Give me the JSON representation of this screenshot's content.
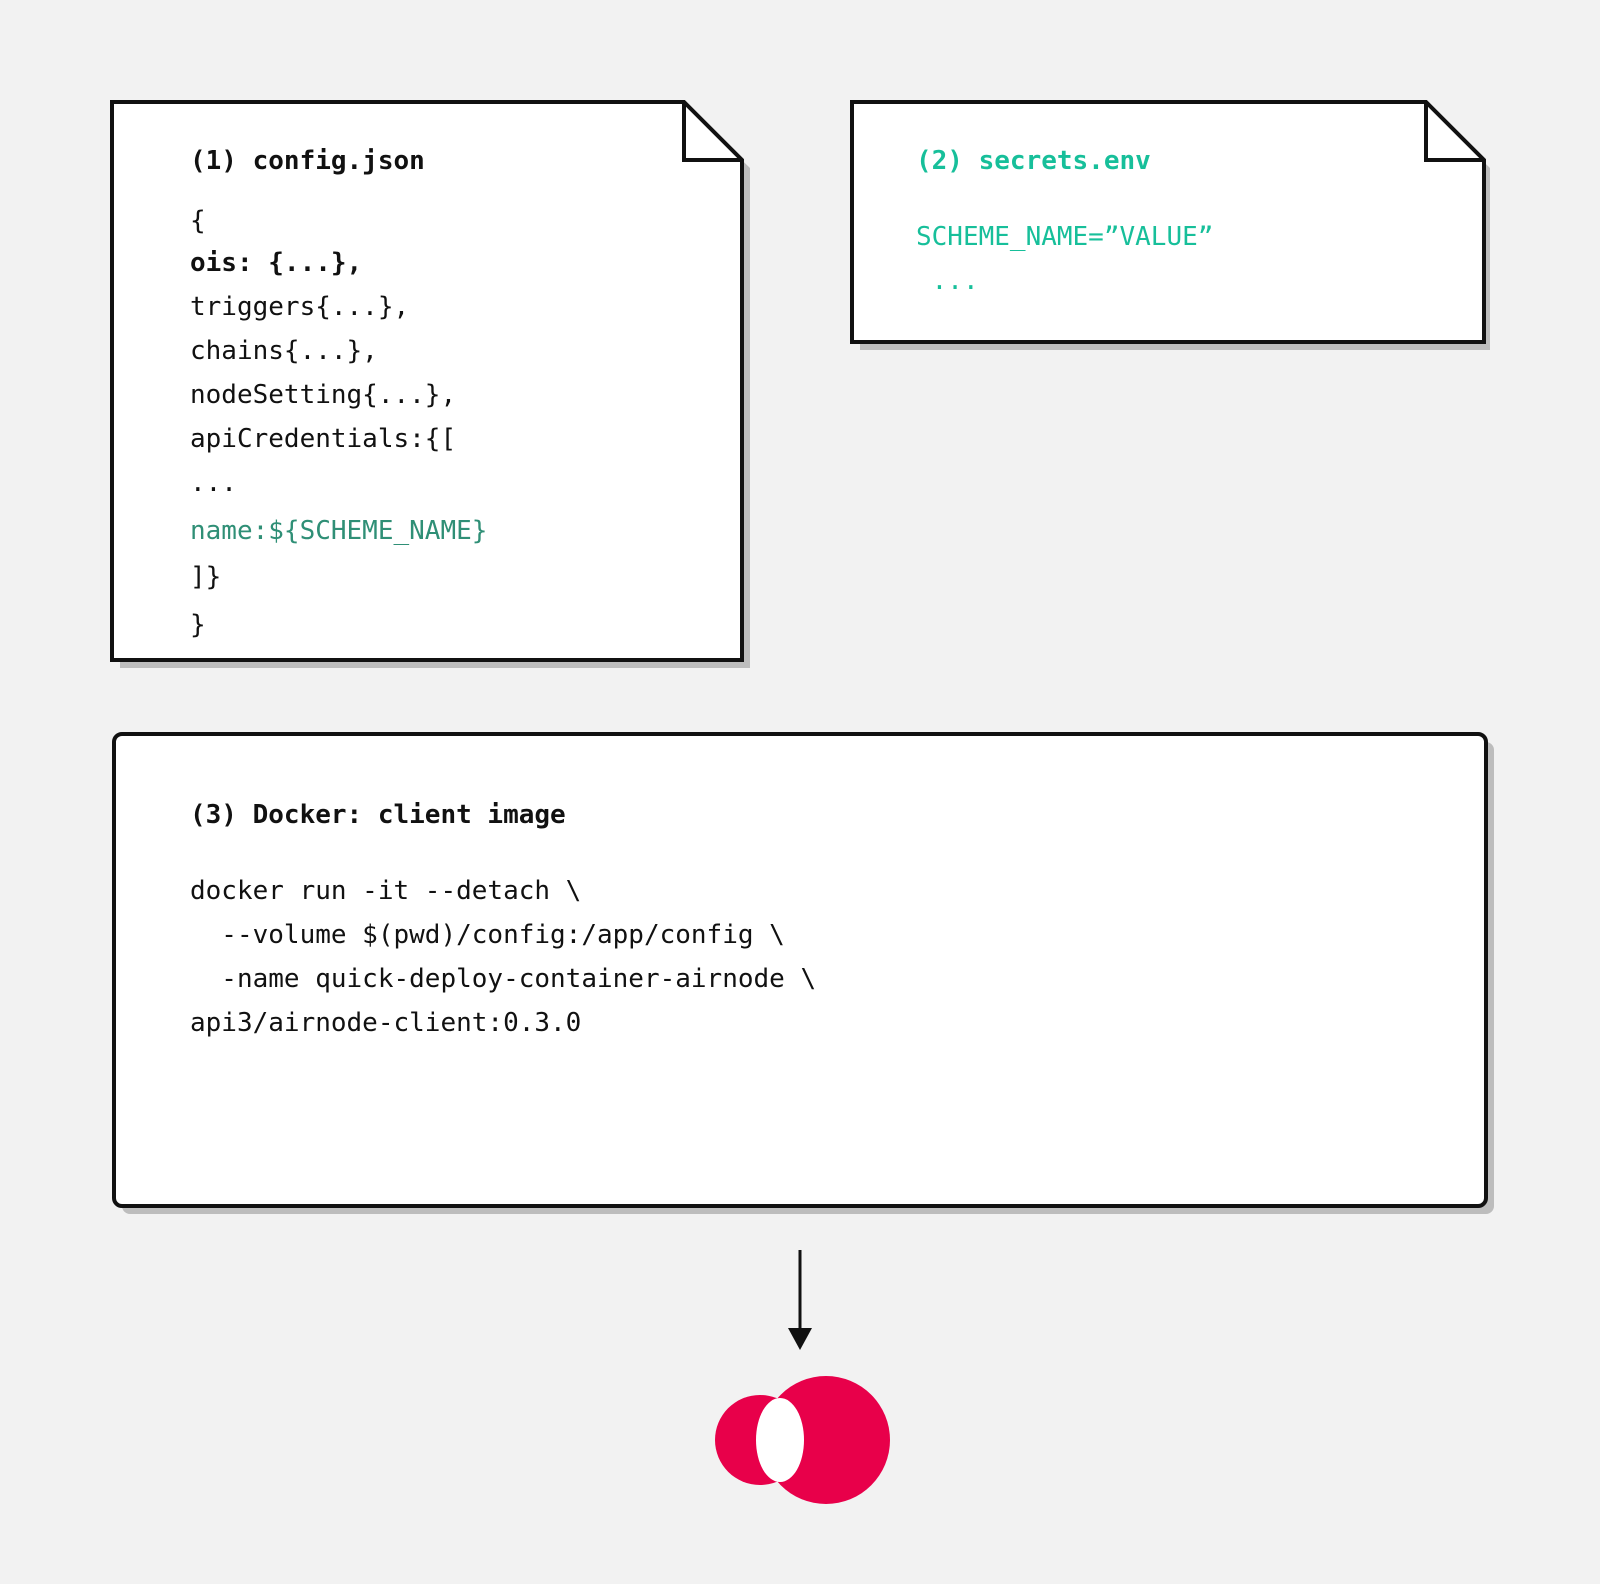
{
  "config_file": {
    "title": "(1) config.json",
    "lines": [
      "{",
      "ois: {...},",
      "triggers{...},",
      "chains{...},",
      "nodeSetting{...},",
      "apiCredentials:{[",
      "...",
      "name:${SCHEME_NAME}",
      "]}",
      "}"
    ]
  },
  "secrets_file": {
    "title": "(2) secrets.env",
    "lines": [
      "SCHEME_NAME=”VALUE”",
      " ..."
    ]
  },
  "docker_box": {
    "title": "(3) Docker: client image",
    "lines": [
      "docker run -it --detach \\",
      "  --volume $(pwd)/config:/app/config \\",
      "  -name quick-deploy-container-airnode \\",
      "api3/airnode-client:0.3.0"
    ]
  },
  "colors": {
    "background": "#f2f2f2",
    "teal_text": "#17bf9a",
    "green_text": "#2f8f76",
    "logo_red": "#e8004a"
  },
  "logo_icon": "api3-logo-icon",
  "arrow_icon": "arrow-down-icon"
}
